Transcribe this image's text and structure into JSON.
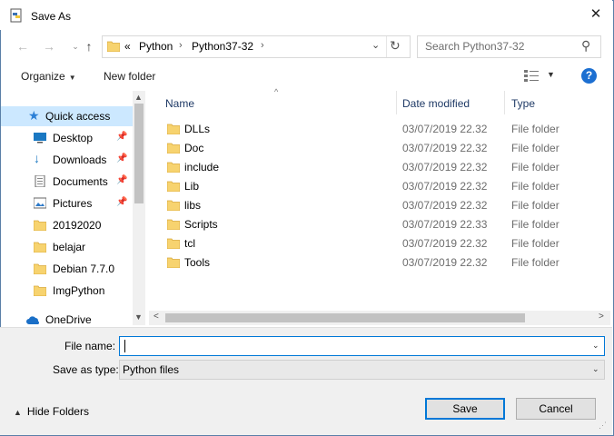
{
  "window": {
    "title": "Save As"
  },
  "address": {
    "overflow": "«",
    "crumbs": [
      "Python",
      "Python37-32"
    ]
  },
  "search": {
    "placeholder": "Search Python37-32"
  },
  "toolbar": {
    "organize": "Organize",
    "new_folder": "New folder"
  },
  "sidebar": {
    "items": [
      {
        "label": "Quick access",
        "icon": "star-icon",
        "selected": true
      },
      {
        "label": "Desktop",
        "icon": "desktop-icon",
        "pinned": true
      },
      {
        "label": "Downloads",
        "icon": "download-icon",
        "pinned": true
      },
      {
        "label": "Documents",
        "icon": "documents-icon",
        "pinned": true
      },
      {
        "label": "Pictures",
        "icon": "pictures-icon",
        "pinned": true
      },
      {
        "label": "20192020",
        "icon": "folder-icon"
      },
      {
        "label": "belajar",
        "icon": "folder-icon"
      },
      {
        "label": "Debian 7.7.0",
        "icon": "folder-icon"
      },
      {
        "label": "ImgPython",
        "icon": "folder-icon"
      },
      {
        "label": "OneDrive",
        "icon": "cloud-icon"
      }
    ]
  },
  "columns": {
    "name": "Name",
    "date": "Date modified",
    "type": "Type"
  },
  "files": [
    {
      "name": "DLLs",
      "date": "03/07/2019 22.32",
      "type": "File folder"
    },
    {
      "name": "Doc",
      "date": "03/07/2019 22.32",
      "type": "File folder"
    },
    {
      "name": "include",
      "date": "03/07/2019 22.32",
      "type": "File folder"
    },
    {
      "name": "Lib",
      "date": "03/07/2019 22.32",
      "type": "File folder"
    },
    {
      "name": "libs",
      "date": "03/07/2019 22.32",
      "type": "File folder"
    },
    {
      "name": "Scripts",
      "date": "03/07/2019 22.33",
      "type": "File folder"
    },
    {
      "name": "tcl",
      "date": "03/07/2019 22.32",
      "type": "File folder"
    },
    {
      "name": "Tools",
      "date": "03/07/2019 22.32",
      "type": "File folder"
    }
  ],
  "form": {
    "file_name_label": "File name:",
    "file_name_value": "",
    "save_as_type_label": "Save as type:",
    "save_as_type_value": "Python files"
  },
  "footer": {
    "hide_folders": "Hide Folders",
    "save": "Save",
    "cancel": "Cancel"
  },
  "colors": {
    "accent": "#0078d7",
    "selection": "#cce8ff",
    "folder": "#f7d36f"
  }
}
